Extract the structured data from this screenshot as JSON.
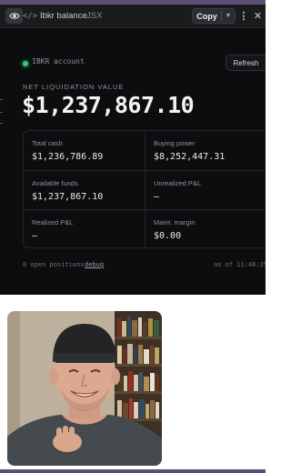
{
  "toolbar": {
    "icons": {
      "preview": "eye-icon",
      "code": "code-icon",
      "more": "more-vertical-icon",
      "close": "close-icon"
    },
    "title": "Ibkr balance",
    "language": "JSX",
    "copy_label": "Copy",
    "code_glyph": "</>"
  },
  "app": {
    "status_color": "#2ecc71",
    "account_label": "IBKR account",
    "refresh_label": "Refresh",
    "nlv_label": "NET LIQUIDATION VALUE",
    "nlv_value": "$1,237,867.10",
    "metrics": [
      {
        "label": "Total cash",
        "value": "$1,236,786.89"
      },
      {
        "label": "Buying power",
        "value": "$8,252,447.31"
      },
      {
        "label": "Available funds",
        "value": "$1,237,867.10"
      },
      {
        "label": "Unrealized P&L",
        "value": "—"
      },
      {
        "label": "Realized P&L",
        "value": "—"
      },
      {
        "label": "Maint. margin",
        "value": "$0.00"
      }
    ],
    "footer_positions": "0 open positions",
    "footer_debug": "debug",
    "footer_time": "as of 11:48:25"
  },
  "colors": {
    "accent_frame": "#5c4f78",
    "app_background": "#0c0d0f",
    "toolbar_background": "#1a1b1d"
  }
}
